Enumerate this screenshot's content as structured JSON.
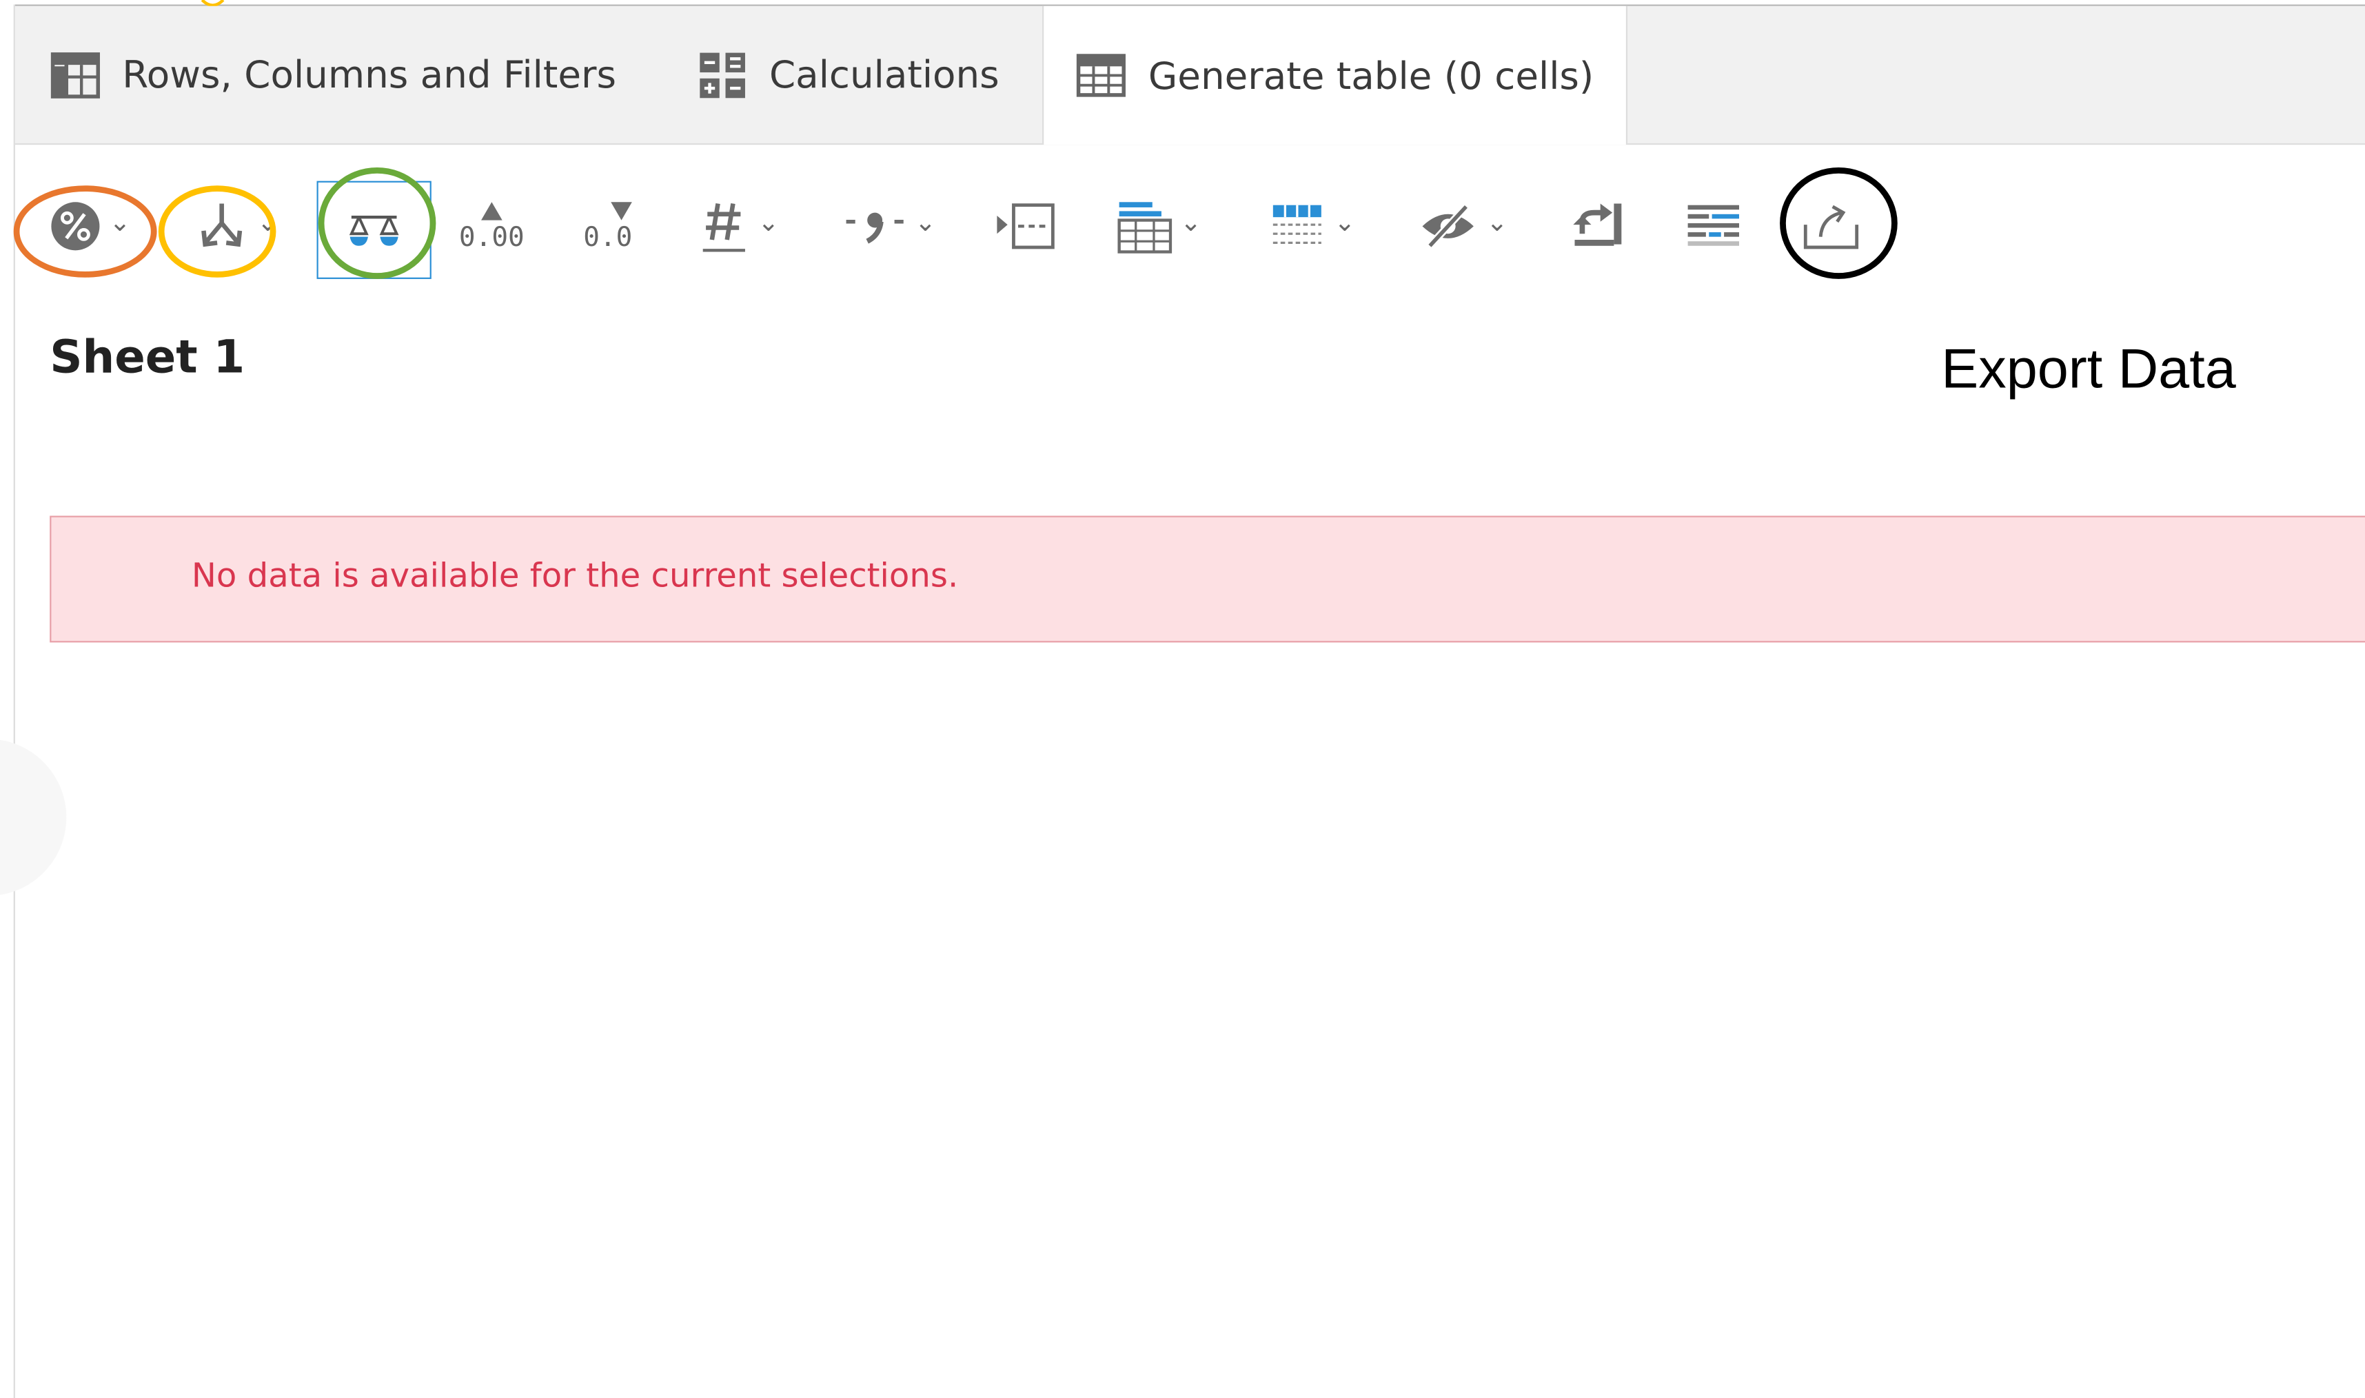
{
  "tabs": [
    {
      "label": "Rows, Columns and Filters",
      "icon": "rows-columns-filters-icon"
    },
    {
      "label": "Calculations",
      "icon": "calculator-icon"
    },
    {
      "label": "Generate table (0 cells)",
      "icon": "table-icon",
      "active": true
    }
  ],
  "toolbar": {
    "tools": [
      {
        "name": "percentage",
        "icon": "percentage-icon",
        "dropdown": true
      },
      {
        "name": "sort",
        "icon": "split-arrows-icon",
        "dropdown": true
      },
      {
        "name": "weight",
        "icon": "scales-icon",
        "selected": true
      },
      {
        "name": "add-decimal",
        "icon": "increase-decimal-icon",
        "label": "0.00"
      },
      {
        "name": "remove-decimal",
        "icon": "decrease-decimal-icon",
        "label": "0.0"
      },
      {
        "name": "number-format",
        "icon": "hash-icon",
        "dropdown": true
      },
      {
        "name": "separator",
        "icon": "comma-separator-icon",
        "dropdown": true
      },
      {
        "name": "transpose",
        "icon": "transpose-icon"
      },
      {
        "name": "table-layout",
        "icon": "table-layout-icon",
        "dropdown": true
      },
      {
        "name": "grid-style",
        "icon": "grid-style-icon",
        "dropdown": true
      },
      {
        "name": "hide",
        "icon": "eye-slash-icon",
        "dropdown": true
      },
      {
        "name": "swap",
        "icon": "swap-icon"
      },
      {
        "name": "summary",
        "icon": "summary-rows-icon"
      },
      {
        "name": "export",
        "icon": "export-icon"
      }
    ],
    "decimal_add_label": "0.00",
    "decimal_remove_label": "0.0"
  },
  "annotations": {
    "export_label": "Export Data",
    "ring_colors": {
      "percentage": "#e8772e",
      "sort": "#ffc000",
      "weight": "#6aaa3a",
      "export": "#000000"
    }
  },
  "sheet": {
    "title": "Sheet 1",
    "message": "No data is available for the current selections."
  },
  "colors": {
    "accent_blue": "#2a8fd6",
    "alert_bg": "#fde0e3",
    "alert_text": "#d9364f",
    "tabbar_bg": "#f1f1f1"
  }
}
